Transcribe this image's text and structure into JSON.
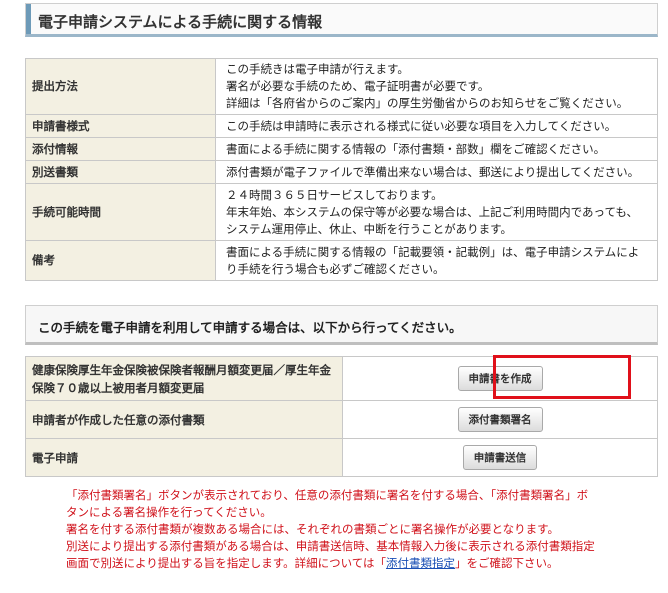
{
  "header": {
    "title": "電子申請システムによる手続に関する情報"
  },
  "info_rows": [
    {
      "label": "提出方法",
      "lines": [
        "この手続きは電子申請が行えます。",
        "署名が必要な手続のため、電子証明書が必要です。",
        "詳細は「各府省からのご案内」の厚生労働省からのお知らせをご覧ください。"
      ]
    },
    {
      "label": "申請書様式",
      "lines": [
        "この手続は申請時に表示される様式に従い必要な項目を入力してください。"
      ]
    },
    {
      "label": "添付情報",
      "lines": [
        "書面による手続に関する情報の「添付書類・部数」欄をご確認ください。"
      ]
    },
    {
      "label": "別送書類",
      "lines": [
        "添付書類が電子ファイルで準備出来ない場合は、郵送により提出してください。"
      ]
    },
    {
      "label": "手続可能時間",
      "lines": [
        "２４時間３６５日サービスしております。",
        "年末年始、本システムの保守等が必要な場合は、上記ご利用時間内であっても、",
        "システム運用停止、休止、中断を行うことがあります。"
      ]
    },
    {
      "label": "備考",
      "lines": [
        "書面による手続に関する情報の「記載要領・記載例」は、電子申請システムによ",
        "り手続を行う場合も必ずご確認ください。"
      ]
    }
  ],
  "notice": {
    "text": "この手続を電子申請を利用して申請する場合は、以下から行ってください。"
  },
  "actions": [
    {
      "label": "健康保険厚生年金保険被保険者報酬月額変更届／厚生年金保険７０歳以上被用者月額変更届",
      "button": "申請書を作成"
    },
    {
      "label": "申請者が作成した任意の添付書類",
      "button": "添付書類署名"
    },
    {
      "label": "電子申請",
      "button": "申請書送信"
    }
  ],
  "notes": {
    "line1": "「添付書類署名」ボタンが表示されており、任意の添付書類に署名を付する場合、「添付書類署名」ボ",
    "line2": "タンによる署名操作を行ってください。",
    "line3": "署名を付する添付書類が複数ある場合には、それぞれの書類ごとに署名操作が必要となります。",
    "line4": "別送により提出する添付書類がある場合は、申請書送信時、基本情報入力後に表示される添付書類指定",
    "line5_pre": "画面で別送により提出する旨を指定します。詳細については「",
    "line5_link": "添付書類指定",
    "line5_post": "」をご確認下さい。"
  },
  "colors": {
    "highlight": "#e0101a",
    "label_bg": "#f3f0e2",
    "note_text": "#d0121b"
  }
}
